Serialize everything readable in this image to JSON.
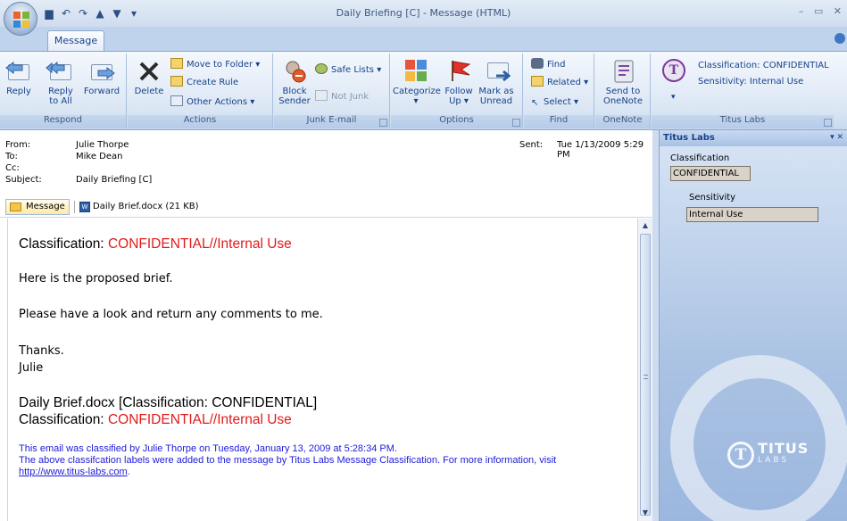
{
  "window": {
    "title": "Daily Briefing [C] - Message (HTML)",
    "controls": "– ▭ ✕"
  },
  "qat": {
    "items": [
      "save-icon",
      "undo-icon",
      "redo-icon",
      "previous-icon",
      "next-icon",
      "customize-icon"
    ]
  },
  "tabs": [
    {
      "label": "Message"
    }
  ],
  "ribbon": {
    "respond": {
      "label": "Respond",
      "reply": "Reply",
      "reply_all_1": "Reply",
      "reply_all_2": "to All",
      "forward": "Forward"
    },
    "actions": {
      "label": "Actions",
      "delete": "Delete",
      "move_to_folder": "Move to Folder ▾",
      "create_rule": "Create Rule",
      "other_actions": "Other Actions ▾"
    },
    "junk": {
      "label": "Junk E-mail",
      "block_sender_1": "Block",
      "block_sender_2": "Sender",
      "safe_lists": "Safe Lists ▾",
      "not_junk": "Not Junk"
    },
    "options": {
      "label": "Options",
      "categorize": "Categorize",
      "categorize_arrow": "▾",
      "follow_up_1": "Follow",
      "follow_up_2": "Up ▾",
      "mark_unread_1": "Mark as",
      "mark_unread_2": "Unread"
    },
    "find": {
      "label": "Find",
      "find": "Find",
      "related": "Related ▾",
      "select": "Select ▾"
    },
    "onenote": {
      "label": "OneNote",
      "send_1": "Send to",
      "send_2": "OneNote"
    },
    "titus": {
      "label": "Titus Labs",
      "classification": "Classification: CONFIDENTIAL",
      "sensitivity": "Sensitivity: Internal Use",
      "dropdown": "▾"
    }
  },
  "header": {
    "from_label": "From:",
    "from_value": "Julie Thorpe",
    "to_label": "To:",
    "to_value": "Mike Dean",
    "cc_label": "Cc:",
    "cc_value": "",
    "subject_label": "Subject:",
    "subject_value": "Daily Briefing [C]",
    "sent_label": "Sent:",
    "sent_value": "Tue 1/13/2009 5:29 PM"
  },
  "attachments": {
    "message_tab": "Message",
    "file": "Daily Brief.docx (21 KB)",
    "file_icon_text": "W"
  },
  "body": {
    "class_prefix": "Classification: ",
    "class_value": "CONFIDENTIAL//Internal Use",
    "p1": "Here is the proposed brief.",
    "p2": "Please have a look and return any comments to me.",
    "thanks": "Thanks.",
    "sign": "Julie",
    "attach_line": "Daily Brief.docx [Classification: CONFIDENTIAL]",
    "class2_prefix": "Classification: ",
    "class2_value": "CONFIDENTIAL//Internal Use",
    "footer1": "This email was classified by Julie Thorpe on Tuesday, January 13, 2009 at 5:28:34 PM.",
    "footer2": "The above classifcation labels were added to the message by Titus Labs Message Classification. For more information, visit",
    "footer_link": "http://www.titus-labs.com",
    "footer_end": "."
  },
  "pane": {
    "title": "Titus Labs",
    "controls": "▾ ✕",
    "classification_label": "Classification",
    "classification_value": "CONFIDENTIAL",
    "sensitivity_label": "Sensitivity",
    "sensitivity_value": "Internal Use",
    "watermark_letter": "T",
    "watermark_word": "TITUS",
    "watermark_sub": "LABS"
  },
  "colors": {
    "accent": "#15428b",
    "classification_red": "#e11b1b",
    "footer_blue": "#1c1cd9",
    "ribbon_bg": "#dbe6f4"
  }
}
